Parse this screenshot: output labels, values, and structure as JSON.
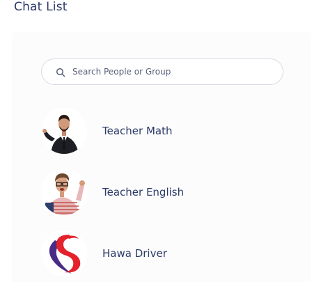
{
  "header": {
    "title": "Chat List"
  },
  "search": {
    "placeholder": "Search People or Group",
    "value": ""
  },
  "chats": [
    {
      "name": "Teacher Math",
      "avatar": "teacher-math-avatar"
    },
    {
      "name": "Teacher English",
      "avatar": "teacher-english-avatar"
    },
    {
      "name": "Hawa Driver",
      "avatar": "hawa-driver-logo"
    }
  ],
  "colors": {
    "title": "#2b3a67",
    "text": "#2b3a67",
    "border": "#d9dbe3",
    "card": "#fcfcfd"
  }
}
